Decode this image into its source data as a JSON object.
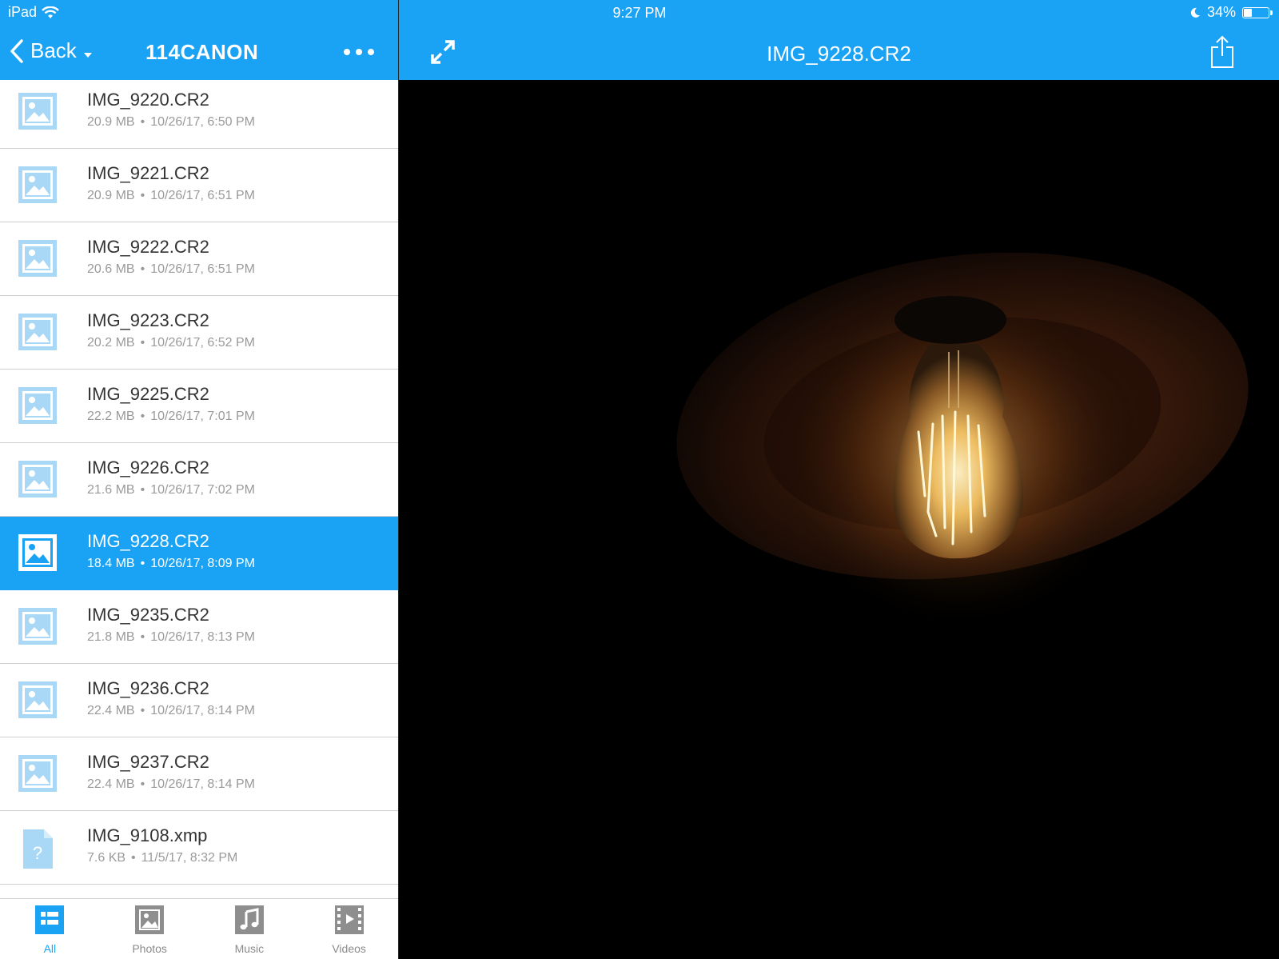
{
  "status": {
    "device": "iPad",
    "time": "9:27 PM",
    "battery": "34%",
    "battery_level": 0.34
  },
  "sidebar": {
    "back_label": "Back",
    "folder_title": "114CANON",
    "files": [
      {
        "name": "IMG_9220.CR2",
        "size": "20.9 MB",
        "date": "10/26/17, 6:50 PM",
        "type": "image"
      },
      {
        "name": "IMG_9221.CR2",
        "size": "20.9 MB",
        "date": "10/26/17, 6:51 PM",
        "type": "image"
      },
      {
        "name": "IMG_9222.CR2",
        "size": "20.6 MB",
        "date": "10/26/17, 6:51 PM",
        "type": "image"
      },
      {
        "name": "IMG_9223.CR2",
        "size": "20.2 MB",
        "date": "10/26/17, 6:52 PM",
        "type": "image"
      },
      {
        "name": "IMG_9225.CR2",
        "size": "22.2 MB",
        "date": "10/26/17, 7:01 PM",
        "type": "image"
      },
      {
        "name": "IMG_9226.CR2",
        "size": "21.6 MB",
        "date": "10/26/17, 7:02 PM",
        "type": "image"
      },
      {
        "name": "IMG_9228.CR2",
        "size": "18.4 MB",
        "date": "10/26/17, 8:09 PM",
        "type": "image",
        "selected": true
      },
      {
        "name": "IMG_9235.CR2",
        "size": "21.8 MB",
        "date": "10/26/17, 8:13 PM",
        "type": "image"
      },
      {
        "name": "IMG_9236.CR2",
        "size": "22.4 MB",
        "date": "10/26/17, 8:14 PM",
        "type": "image"
      },
      {
        "name": "IMG_9237.CR2",
        "size": "22.4 MB",
        "date": "10/26/17, 8:14 PM",
        "type": "image"
      },
      {
        "name": "IMG_9108.xmp",
        "size": "7.6 KB",
        "date": "11/5/17, 8:32 PM",
        "type": "unknown"
      }
    ],
    "tabs": [
      {
        "label": "All",
        "icon": "all-icon",
        "active": true
      },
      {
        "label": "Photos",
        "icon": "photos-icon"
      },
      {
        "label": "Music",
        "icon": "music-icon"
      },
      {
        "label": "Videos",
        "icon": "videos-icon"
      }
    ]
  },
  "viewer": {
    "title": "IMG_9228.CR2"
  },
  "colors": {
    "accent": "#1aa3f5",
    "icon_light": "#a9d8f7",
    "text": "#333333",
    "meta": "#9a9a9a"
  }
}
